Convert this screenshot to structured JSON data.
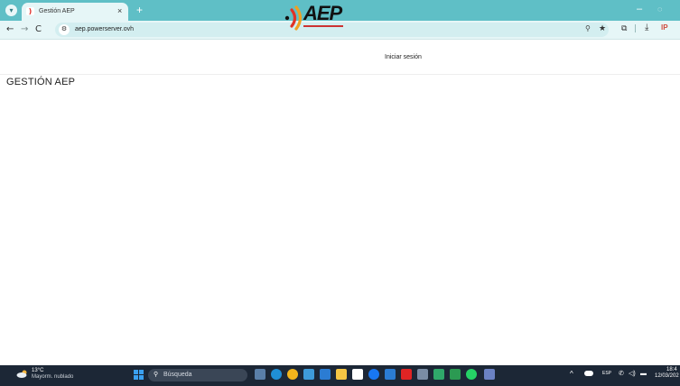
{
  "browser": {
    "tab": {
      "title": "Gestión AEP",
      "close": "×"
    },
    "new_tab": "+",
    "window": {
      "minimize": "–",
      "restore": "◌"
    },
    "nav": {
      "back": "←",
      "forward": "→",
      "reload": "C"
    },
    "url": "aep.powerserver.ovh",
    "icons": {
      "zoom": "⚲",
      "star": "★",
      "extensions": "⧉",
      "download": "⤓",
      "profile": "lP"
    },
    "accent": "#5fbfc6"
  },
  "page": {
    "logo_text": "AEP",
    "login_label": "Iniciar sesión",
    "heading": "GESTIÓN AEP"
  },
  "taskbar": {
    "weather_temp": "13°C",
    "weather_desc": "Mayorm. nublado",
    "search_placeholder": "Búsqueda",
    "search_icon": "⚲",
    "tray": {
      "up": "^",
      "lang": "ESP",
      "wifi": "✆",
      "volume": "◁)",
      "battery": "▬"
    },
    "time": "18:4",
    "date": "12/03/202"
  }
}
